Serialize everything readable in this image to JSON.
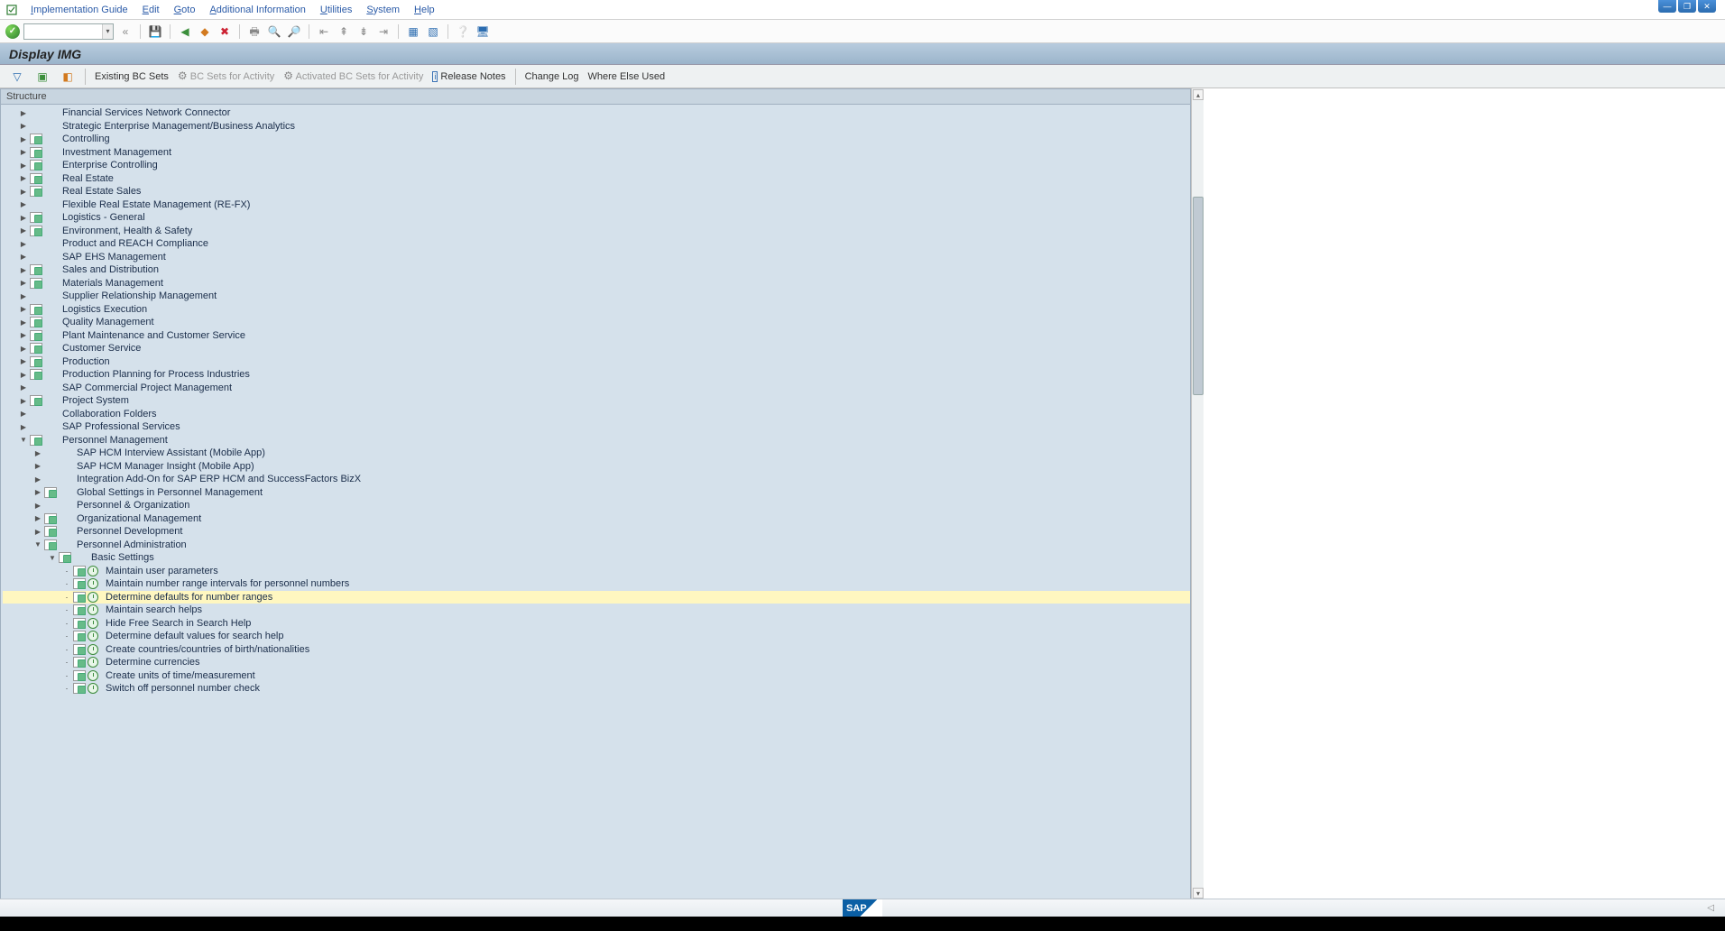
{
  "menubar": {
    "items": [
      "Implementation Guide",
      "Edit",
      "Goto",
      "Additional Information",
      "Utilities",
      "System",
      "Help"
    ]
  },
  "titlebar": {
    "title": "Display IMG"
  },
  "apptoolbar": {
    "existing_bc": "Existing BC Sets",
    "bc_for_activity": "BC Sets for Activity",
    "activated_bc": "Activated BC Sets for Activity",
    "release_notes": "Release Notes",
    "change_log": "Change Log",
    "where_else": "Where Else Used"
  },
  "structure": {
    "header": "Structure",
    "rows": [
      {
        "indent": 1,
        "exp": "collapsed",
        "icons": [],
        "label": "Financial Services Network Connector"
      },
      {
        "indent": 1,
        "exp": "collapsed",
        "icons": [],
        "label": "Strategic Enterprise Management/Business Analytics"
      },
      {
        "indent": 1,
        "exp": "collapsed",
        "icons": [
          "page"
        ],
        "label": "Controlling"
      },
      {
        "indent": 1,
        "exp": "collapsed",
        "icons": [
          "page"
        ],
        "label": "Investment Management"
      },
      {
        "indent": 1,
        "exp": "collapsed",
        "icons": [
          "page"
        ],
        "label": "Enterprise Controlling"
      },
      {
        "indent": 1,
        "exp": "collapsed",
        "icons": [
          "page"
        ],
        "label": "Real Estate"
      },
      {
        "indent": 1,
        "exp": "collapsed",
        "icons": [
          "page"
        ],
        "label": "Real Estate Sales"
      },
      {
        "indent": 1,
        "exp": "collapsed",
        "icons": [],
        "label": "Flexible Real Estate Management (RE-FX)"
      },
      {
        "indent": 1,
        "exp": "collapsed",
        "icons": [
          "page"
        ],
        "label": "Logistics - General"
      },
      {
        "indent": 1,
        "exp": "collapsed",
        "icons": [
          "page"
        ],
        "label": "Environment, Health & Safety"
      },
      {
        "indent": 1,
        "exp": "collapsed",
        "icons": [],
        "label": "Product and REACH Compliance"
      },
      {
        "indent": 1,
        "exp": "collapsed",
        "icons": [],
        "label": "SAP EHS Management"
      },
      {
        "indent": 1,
        "exp": "collapsed",
        "icons": [
          "page"
        ],
        "label": "Sales and Distribution"
      },
      {
        "indent": 1,
        "exp": "collapsed",
        "icons": [
          "page"
        ],
        "label": "Materials Management"
      },
      {
        "indent": 1,
        "exp": "collapsed",
        "icons": [],
        "label": "Supplier Relationship Management"
      },
      {
        "indent": 1,
        "exp": "collapsed",
        "icons": [
          "page"
        ],
        "label": "Logistics Execution"
      },
      {
        "indent": 1,
        "exp": "collapsed",
        "icons": [
          "page"
        ],
        "label": "Quality Management"
      },
      {
        "indent": 1,
        "exp": "collapsed",
        "icons": [
          "page"
        ],
        "label": "Plant Maintenance and Customer Service"
      },
      {
        "indent": 1,
        "exp": "collapsed",
        "icons": [
          "page"
        ],
        "label": "Customer Service"
      },
      {
        "indent": 1,
        "exp": "collapsed",
        "icons": [
          "page"
        ],
        "label": "Production"
      },
      {
        "indent": 1,
        "exp": "collapsed",
        "icons": [
          "page"
        ],
        "label": "Production Planning for Process Industries"
      },
      {
        "indent": 1,
        "exp": "collapsed",
        "icons": [],
        "label": "SAP Commercial Project Management"
      },
      {
        "indent": 1,
        "exp": "collapsed",
        "icons": [
          "page"
        ],
        "label": "Project System"
      },
      {
        "indent": 1,
        "exp": "collapsed",
        "icons": [],
        "label": "Collaboration Folders"
      },
      {
        "indent": 1,
        "exp": "collapsed",
        "icons": [],
        "label": "SAP Professional Services"
      },
      {
        "indent": 1,
        "exp": "expanded",
        "icons": [
          "page"
        ],
        "label": "Personnel Management"
      },
      {
        "indent": 2,
        "exp": "collapsed",
        "icons": [],
        "label": "SAP HCM Interview Assistant (Mobile App)"
      },
      {
        "indent": 2,
        "exp": "collapsed",
        "icons": [],
        "label": "SAP HCM Manager Insight (Mobile App)"
      },
      {
        "indent": 2,
        "exp": "collapsed",
        "icons": [],
        "label": "Integration Add-On for SAP ERP HCM and SuccessFactors BizX"
      },
      {
        "indent": 2,
        "exp": "collapsed",
        "icons": [
          "page"
        ],
        "label": "Global Settings in Personnel Management"
      },
      {
        "indent": 2,
        "exp": "collapsed",
        "icons": [],
        "label": "Personnel & Organization"
      },
      {
        "indent": 2,
        "exp": "collapsed",
        "icons": [
          "page"
        ],
        "label": "Organizational Management"
      },
      {
        "indent": 2,
        "exp": "collapsed",
        "icons": [
          "page"
        ],
        "label": "Personnel Development"
      },
      {
        "indent": 2,
        "exp": "expanded",
        "icons": [
          "page"
        ],
        "label": "Personnel Administration"
      },
      {
        "indent": 3,
        "exp": "expanded",
        "icons": [
          "page"
        ],
        "label": "Basic Settings"
      },
      {
        "indent": 4,
        "exp": "leaf",
        "icons": [
          "page",
          "clock"
        ],
        "label": "Maintain user parameters"
      },
      {
        "indent": 4,
        "exp": "leaf",
        "icons": [
          "page",
          "clock"
        ],
        "label": "Maintain number range intervals for personnel numbers"
      },
      {
        "indent": 4,
        "exp": "leaf",
        "icons": [
          "page",
          "clock"
        ],
        "label": "Determine defaults for number ranges",
        "highlight": true
      },
      {
        "indent": 4,
        "exp": "leaf",
        "icons": [
          "page",
          "clock"
        ],
        "label": "Maintain search helps"
      },
      {
        "indent": 4,
        "exp": "leaf",
        "icons": [
          "page",
          "clock"
        ],
        "label": "Hide Free Search in Search Help"
      },
      {
        "indent": 4,
        "exp": "leaf",
        "icons": [
          "page",
          "clock"
        ],
        "label": "Determine default values for search help"
      },
      {
        "indent": 4,
        "exp": "leaf",
        "icons": [
          "page",
          "clock"
        ],
        "label": "Create countries/countries of birth/nationalities"
      },
      {
        "indent": 4,
        "exp": "leaf",
        "icons": [
          "page",
          "clock"
        ],
        "label": "Determine currencies"
      },
      {
        "indent": 4,
        "exp": "leaf",
        "icons": [
          "page",
          "clock"
        ],
        "label": "Create units of time/measurement"
      },
      {
        "indent": 4,
        "exp": "leaf",
        "icons": [
          "page",
          "clock"
        ],
        "label": "Switch off personnel number check"
      }
    ]
  },
  "footer": {
    "sap": "SAP"
  }
}
